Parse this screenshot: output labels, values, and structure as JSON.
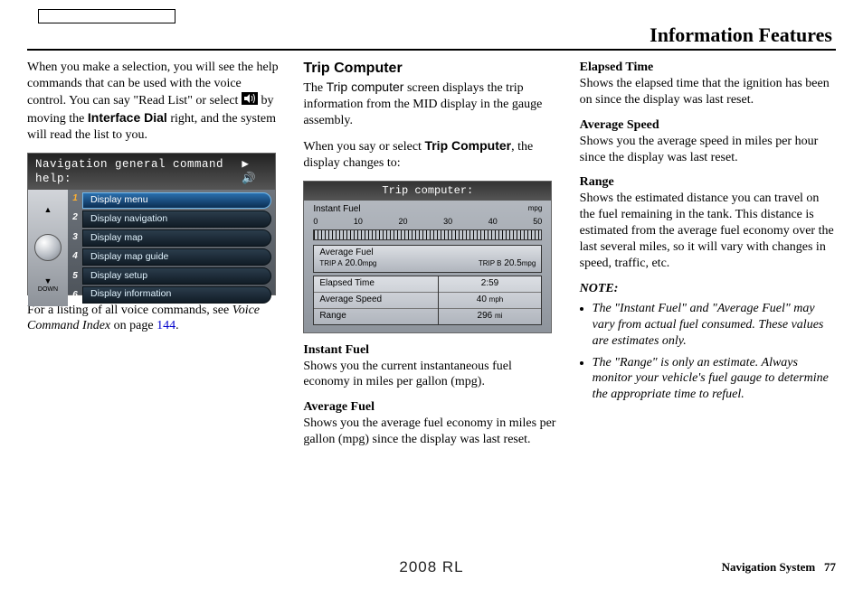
{
  "header": {
    "title": "Information Features"
  },
  "col1": {
    "para1_a": "When you make a selection, you will see the help commands that can be used with the voice control. You can say \"Read List\" or select ",
    "para1_b": " by moving the ",
    "interface_dial": "Interface Dial",
    "para1_c": " right, and the system will read the list to you.",
    "nav_header": "Navigation general command help:",
    "nav_items": [
      "Display menu",
      "Display navigation",
      "Display map",
      "Display map guide",
      "Display setup",
      "Display information"
    ],
    "para2_a": "For a listing of all voice commands, see ",
    "voice_index": "Voice Command Index",
    "para2_b": " on page ",
    "page_ref": "144",
    "para2_c": "."
  },
  "col2": {
    "heading": "Trip Computer",
    "para1_a": "The ",
    "trip_label": "Trip computer",
    "para1_b": " screen displays the trip information from the MID display in the gauge assembly.",
    "para2_a": "When you say or select ",
    "trip_bold": "Trip Computer",
    "para2_b": ", the display changes to:",
    "trip": {
      "header": "Trip computer:",
      "instant_label": "Instant Fuel",
      "mpg": "mpg",
      "scale": [
        "0",
        "10",
        "20",
        "30",
        "40",
        "50"
      ],
      "avg_label": "Average Fuel",
      "trip_a_label": "TRIP A",
      "trip_a_val": "20.0",
      "trip_b_label": "TRIP B",
      "trip_b_val": "20.5",
      "rows": [
        {
          "label": "Elapsed Time",
          "val": "2:59",
          "unit": ""
        },
        {
          "label": "Average Speed",
          "val": "40",
          "unit": "mph"
        },
        {
          "label": "Range",
          "val": "296",
          "unit": "mi"
        }
      ]
    },
    "instant_h": "Instant Fuel",
    "instant_p": "Shows you the current instantaneous fuel economy in miles per gallon (mpg).",
    "avg_h": "Average Fuel",
    "avg_p": "Shows you the average fuel economy in miles per gallon (mpg) since the display was last reset."
  },
  "col3": {
    "elapsed_h": "Elapsed Time",
    "elapsed_p": "Shows the elapsed time that the ignition has been on since the display was last reset.",
    "avgspeed_h": "Average Speed",
    "avgspeed_p": "Shows you the average speed in miles per hour since the display was last reset.",
    "range_h": "Range",
    "range_p": "Shows the estimated distance you can travel on the fuel remaining in the tank. This distance is estimated from the average fuel economy over the last several miles, so it will vary with changes in speed, traffic, etc.",
    "note_h": "NOTE:",
    "note1": "The \"Instant Fuel\" and \"Average Fuel\" may vary from actual fuel consumed. These values are estimates only.",
    "note2": "The \"Range\" is only an estimate. Always monitor your vehicle's fuel gauge to determine the appropriate time to refuel."
  },
  "footer": {
    "center": "2008 RL",
    "right_label": "Navigation System",
    "page_num": "77"
  }
}
